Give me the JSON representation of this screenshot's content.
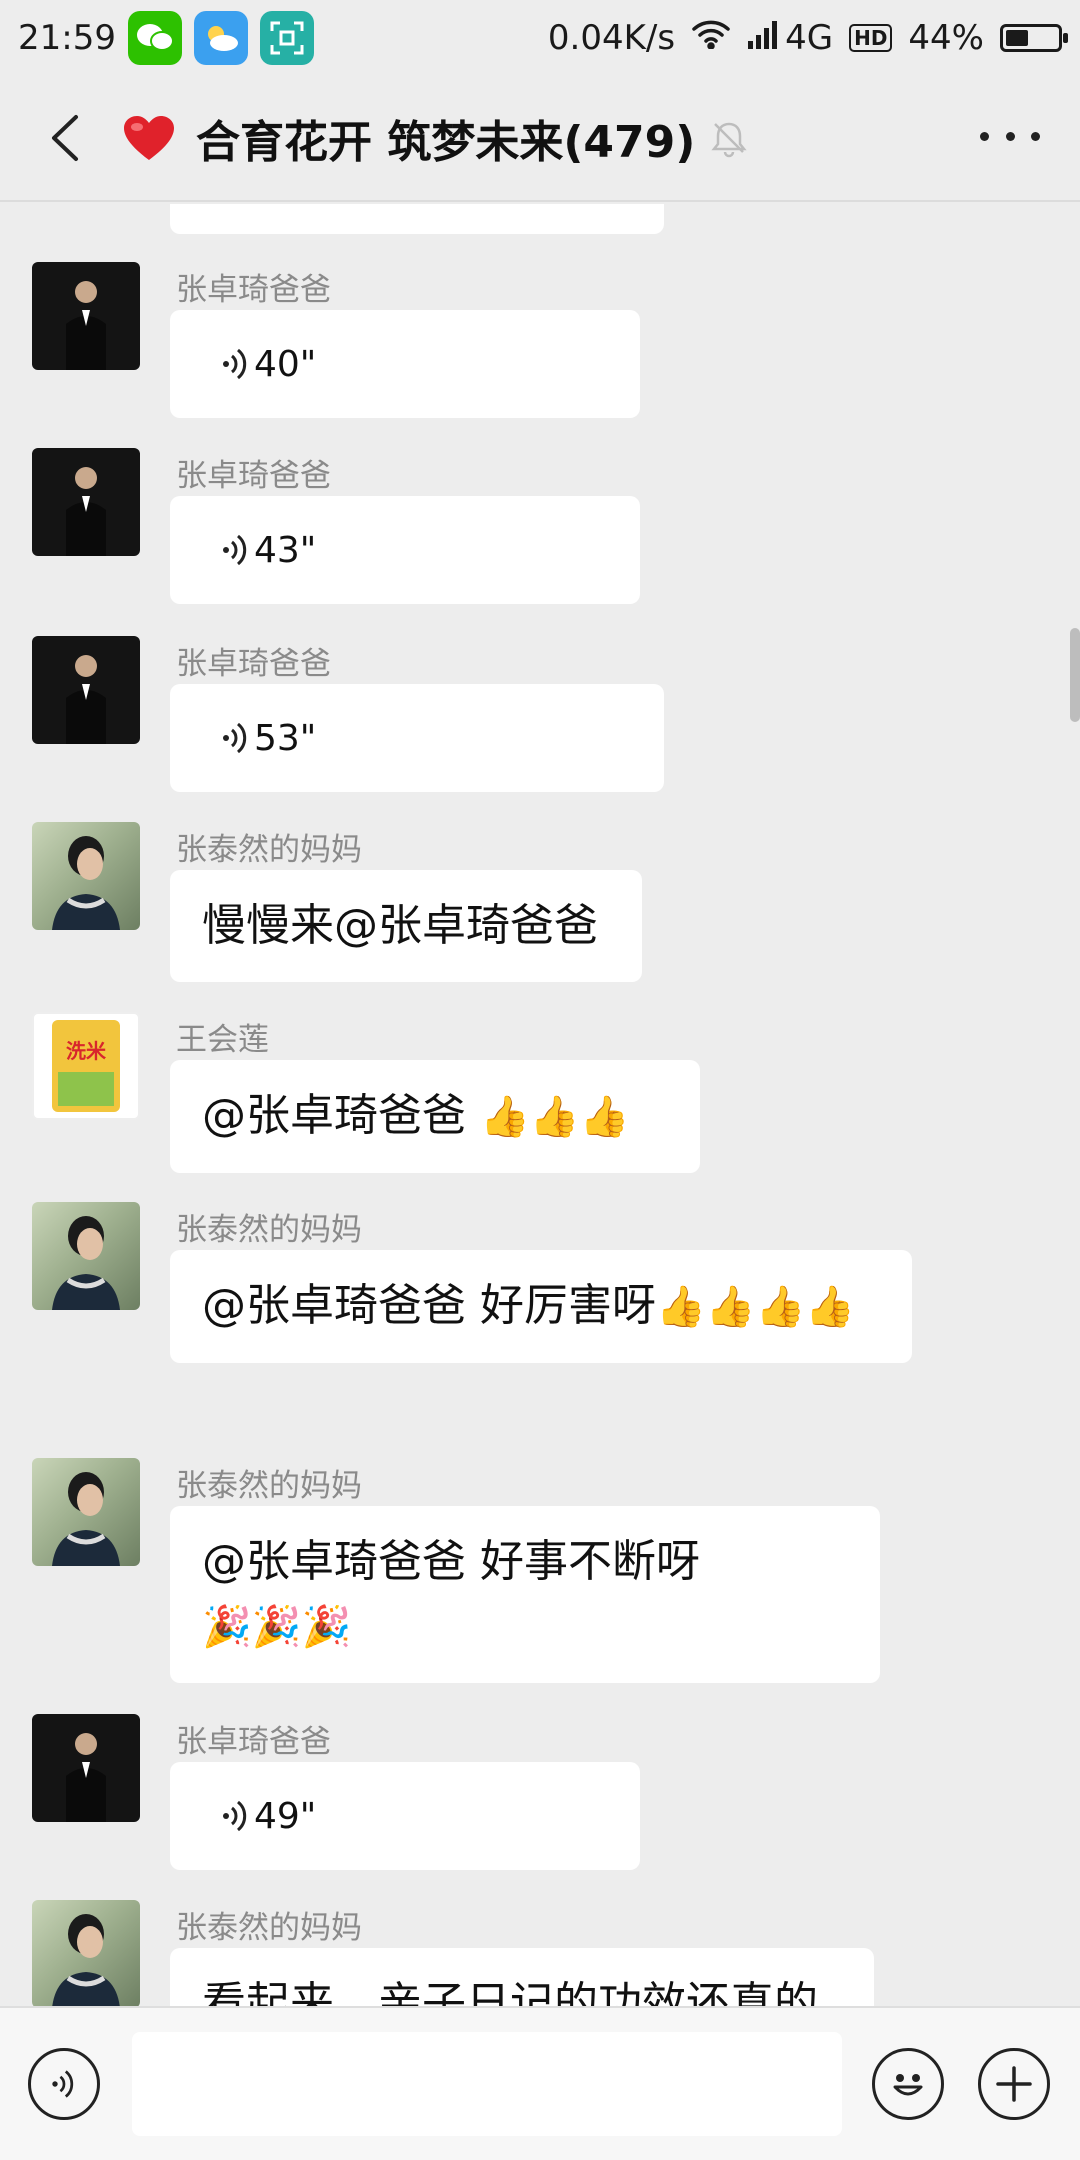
{
  "status_bar": {
    "time": "21:59",
    "network_speed": "0.04K/s",
    "network_type": "4G",
    "hd_label": "HD",
    "battery_percent": "44%",
    "battery_level": 0.44,
    "app_icons": [
      "wechat-icon",
      "weather-icon",
      "scan-icon"
    ]
  },
  "header": {
    "back_icon": "chevron-left-icon",
    "group_emoji": "❤️",
    "title": "合育花开 筑梦未来(479)",
    "muted_icon": "bell-off-icon",
    "more_icon": "more-dots-icon"
  },
  "messages": [
    {
      "sender": "张卓琦爸爸",
      "type": "voice",
      "duration": "40\"",
      "avatar": "man-in-suit"
    },
    {
      "sender": "张卓琦爸爸",
      "type": "voice",
      "duration": "43\"",
      "avatar": "man-in-suit"
    },
    {
      "sender": "张卓琦爸爸",
      "type": "voice",
      "duration": "53\"",
      "avatar": "man-in-suit"
    },
    {
      "sender": "张泰然的妈妈",
      "type": "text",
      "text": "慢慢来@张卓琦爸爸",
      "avatar": "woman-portrait"
    },
    {
      "sender": "王会莲",
      "type": "text",
      "text": "@张卓琦爸爸 ",
      "emojis": "👍👍👍",
      "avatar": "rice-bag"
    },
    {
      "sender": "张泰然的妈妈",
      "type": "text",
      "text": "@张卓琦爸爸  好厉害呀",
      "emojis": "👍👍👍👍",
      "avatar": "woman-portrait"
    },
    {
      "sender": "张泰然的妈妈",
      "type": "text",
      "text": "@张卓琦爸爸  好事不断呀",
      "emojis": "🎉🎉🎉",
      "avatar": "woman-portrait"
    },
    {
      "sender": "张卓琦爸爸",
      "type": "voice",
      "duration": "49\"",
      "avatar": "man-in-suit"
    },
    {
      "sender": "张泰然的妈妈",
      "type": "text",
      "text": "看起来，亲子日记的功效还真的不",
      "avatar": "woman-portrait"
    }
  ],
  "input_bar": {
    "voice_icon": "voice-input-icon",
    "text_value": "",
    "emoji_icon": "smiley-icon",
    "plus_icon": "plus-icon"
  }
}
